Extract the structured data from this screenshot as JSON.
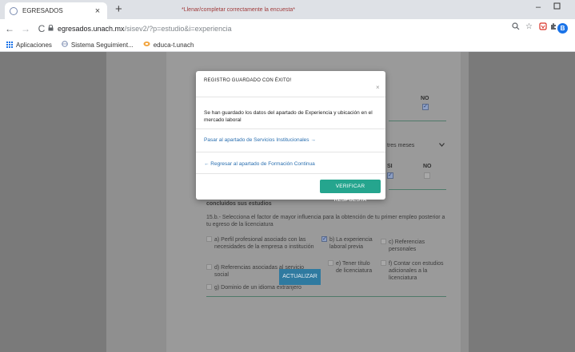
{
  "browser": {
    "tab_title": "EGRESADOS",
    "tab_close": "×",
    "new_tab": "+",
    "window_controls": {
      "minimize": "–",
      "maximize": "▫",
      "close": ""
    },
    "nav": {
      "back": "←",
      "forward": "→",
      "reload": "C"
    },
    "url_host": "egresados.unach.mx",
    "url_path": "/sisev2/?p=estudio&i=experiencia",
    "bookmarks": [
      {
        "label": "Aplicaciones",
        "icon": "apps-grid-icon"
      },
      {
        "label": "Sistema Seguimient...",
        "icon": "globe-icon"
      },
      {
        "label": "educa-t.unach",
        "icon": "educa-icon"
      }
    ],
    "profile_initial": "B",
    "toolbar_icons": [
      "zoom-icon",
      "star-icon",
      "shield-extension-icon",
      "puzzle-extension-icon"
    ]
  },
  "page": {
    "required_note": "*Llenar/completar correctamente la encuesta*",
    "no_label": "NO",
    "si_label": "SI",
    "no_label_2": "NO",
    "select_value": "tres meses",
    "partial_label": "concluidos sus estudios",
    "question": "15.b.- Selecciona el factor de mayor influencia para la obtención de tu primer empleo posterior a tu egreso de la licenciatura",
    "options": [
      {
        "label": "a) Perfil profesional asociado con las necesidades de la empresa o institución",
        "checked": false
      },
      {
        "label": "b) La experiencia laboral previa",
        "checked": true
      },
      {
        "label": "c) Referencias personales",
        "checked": false
      },
      {
        "label": "d) Referencias asociadas al servicio social",
        "checked": false
      },
      {
        "label": "e) Tener título de licenciatura",
        "checked": false
      },
      {
        "label": "f) Contar con estudios adicionales a la licenciatura",
        "checked": false
      },
      {
        "label": "g) Dominio de un idioma extranjero",
        "checked": false
      }
    ],
    "update_button": "ACTUALIZAR"
  },
  "modal": {
    "title": "REGISTRO GUARDADO CON ÉXITO!",
    "close": "×",
    "body": "Se han guardado los datos del apartado de Experiencia y ubicación en el mercado laboral",
    "next_link": "Pasar al apartado de Servicios Institucionales →",
    "back_link": "← Regresar al apartado de Formación Continua",
    "verify_button": "VERIFICAR RESPUESTA"
  },
  "colors": {
    "modal_button": "#25a58e",
    "link": "#2a6fb0",
    "overlay_side": "#7a7a7a",
    "profile": "#1a73e8"
  }
}
